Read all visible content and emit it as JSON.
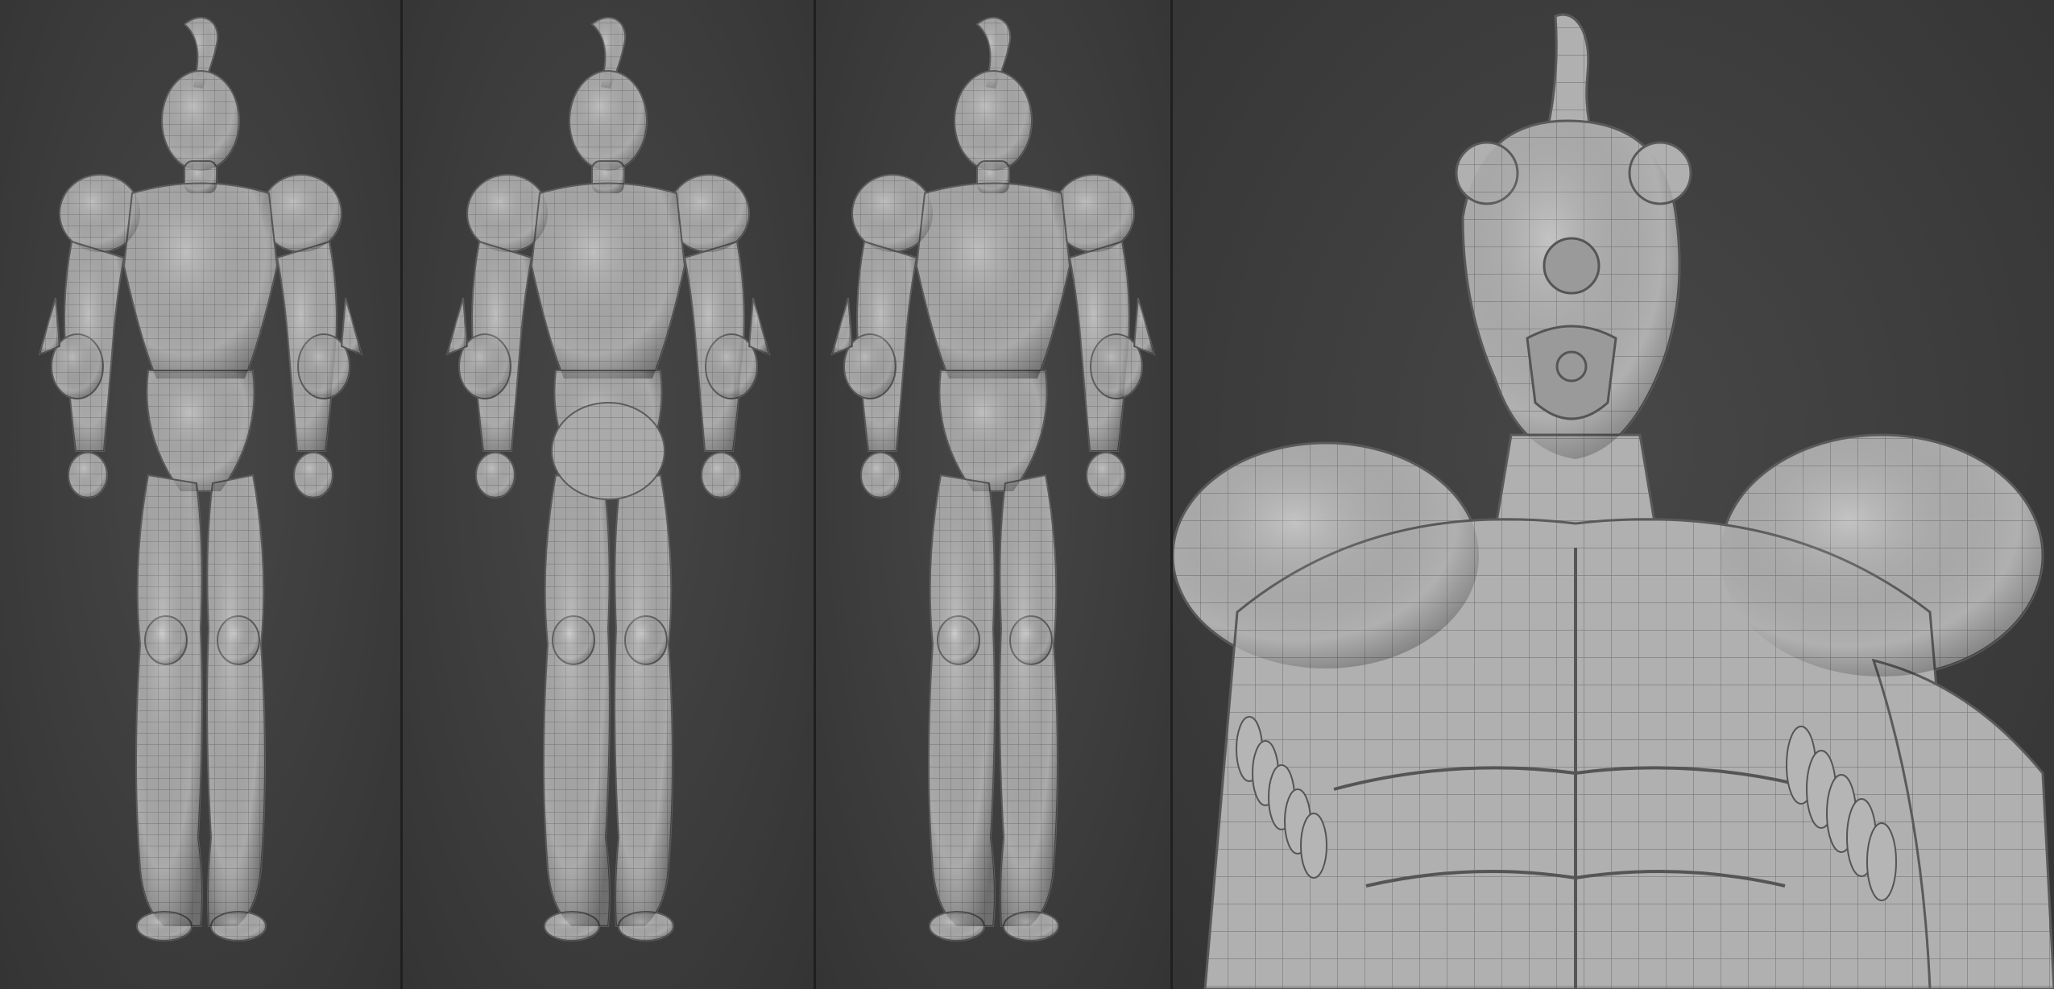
{
  "sheet": {
    "panels": [
      {
        "view": "front"
      },
      {
        "view": "back"
      },
      {
        "view": "three-quarter"
      },
      {
        "view": "closeup"
      }
    ],
    "colors": {
      "background": "#3d3d3d",
      "divider": "#1f1f1f",
      "model_surface": "#a9a9a9",
      "wireframe": "#6e6e6e"
    }
  }
}
